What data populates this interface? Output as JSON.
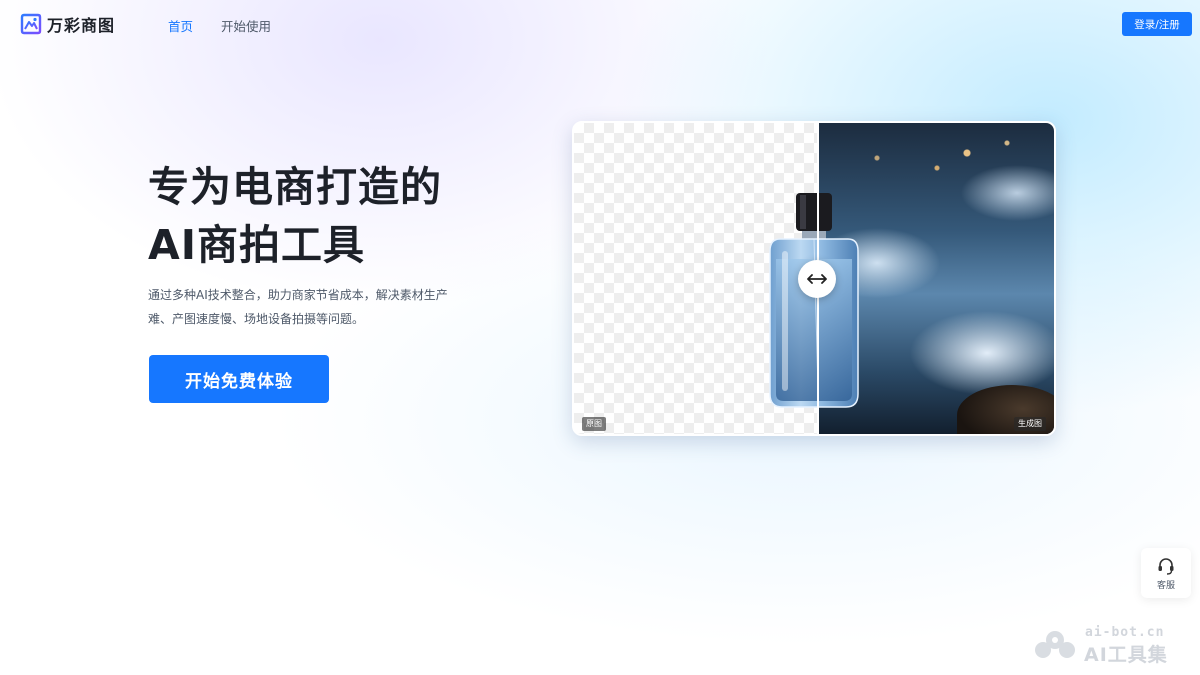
{
  "header": {
    "logo_text": "万彩商图",
    "nav": [
      {
        "label": "首页",
        "active": true
      },
      {
        "label": "开始使用",
        "active": false
      }
    ],
    "login_label": "登录/注册"
  },
  "hero": {
    "title_line1": "专为电商打造的",
    "title_line2": "AI商拍工具",
    "description": "通过多种AI技术整合，助力商家节省成本，解决素材生产难、产图速度慢、场地设备拍摄等问题。",
    "cta_label": "开始免费体验"
  },
  "compare": {
    "left_tag": "原图",
    "right_tag": "生成图",
    "handle_icon": "left-right-arrow-icon"
  },
  "support": {
    "label": "客服",
    "icon": "headset-icon"
  },
  "watermark": {
    "domain": "ai-bot.cn",
    "name": "AI工具集"
  },
  "colors": {
    "accent": "#1677ff",
    "text_dark": "#1d2129",
    "text_muted": "#4e5969"
  }
}
